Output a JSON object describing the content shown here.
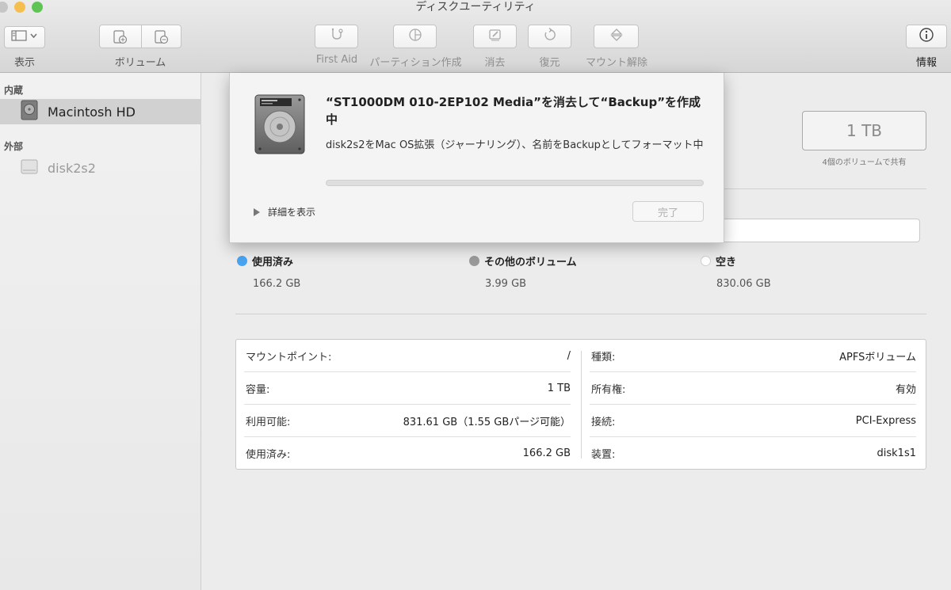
{
  "window": {
    "title": "ディスクユーティリティ"
  },
  "toolbar": {
    "view_label": "表示",
    "volume_label": "ボリューム",
    "first_aid_label": "First Aid",
    "partition_label": "パーティション作成",
    "erase_label": "消去",
    "restore_label": "復元",
    "unmount_label": "マウント解除",
    "info_label": "情報"
  },
  "sidebar": {
    "internal_header": "内蔵",
    "external_header": "外部",
    "items": [
      {
        "label": "Macintosh HD",
        "selected": true
      },
      {
        "label": "disk2s2",
        "selected": false
      }
    ]
  },
  "main": {
    "capacity": "1 TB",
    "capacity_note": "4個のボリュームで共有",
    "legend": [
      {
        "label": "使用済み",
        "value": "166.2 GB",
        "color": "#4aa3f0"
      },
      {
        "label": "その他のボリューム",
        "value": "3.99 GB",
        "color": "#9a9a9a"
      },
      {
        "label": "空き",
        "value": "830.06 GB",
        "color": "#ffffff"
      }
    ],
    "info_left": [
      {
        "key": "マウントポイント:",
        "value": "/"
      },
      {
        "key": "容量:",
        "value": "1 TB"
      },
      {
        "key": "利用可能:",
        "value": "831.61 GB（1.55 GBパージ可能）"
      },
      {
        "key": "使用済み:",
        "value": "166.2 GB"
      }
    ],
    "info_right": [
      {
        "key": "種類:",
        "value": "APFSボリューム"
      },
      {
        "key": "所有権:",
        "value": "有効"
      },
      {
        "key": "接続:",
        "value": "PCI-Express"
      },
      {
        "key": "装置:",
        "value": "disk1s1"
      }
    ]
  },
  "sheet": {
    "title": "“ST1000DM 010-2EP102 Media”を消去して“Backup”を作成中",
    "description": "disk2s2をMac OS拡張（ジャーナリング）、名前をBackupとしてフォーマット中",
    "progress": 0,
    "details_label": "詳細を表示",
    "done_label": "完了"
  },
  "colors": {
    "accent_blue": "#4aa3f0",
    "other_gray": "#9a9a9a"
  }
}
